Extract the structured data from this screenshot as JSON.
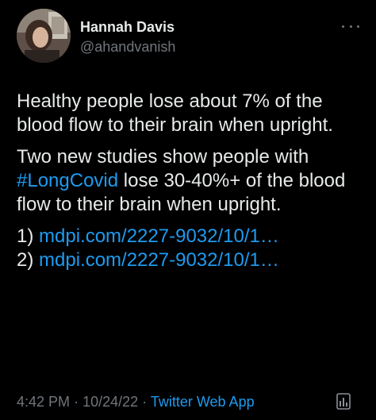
{
  "author": {
    "name": "Hannah Davis",
    "handle": "@ahandvanish"
  },
  "tweet": {
    "paragraph1": "Healthy people lose about 7% of the blood flow to their brain when upright.",
    "paragraph2_hashtag": "#LongCovid",
    "paragraph2_pre": "Two new studies show people with ",
    "paragraph2_post": " lose 30-40%+ of the blood flow to their brain when upright.",
    "link1_prefix": "1) ",
    "link1_text": "mdpi.com/2227-9032/10/1…",
    "link2_prefix": "2) ",
    "link2_text": "mdpi.com/2227-9032/10/1…"
  },
  "meta": {
    "time": "4:42 PM",
    "date": "10/24/22",
    "source": "Twitter Web App",
    "separator": "·"
  },
  "icons": {
    "more": "more-horizontal-icon",
    "analytics": "analytics-icon"
  },
  "colors": {
    "background": "#000000",
    "text": "#e7e9ea",
    "secondary": "#71767b",
    "link": "#1d9bf0"
  }
}
